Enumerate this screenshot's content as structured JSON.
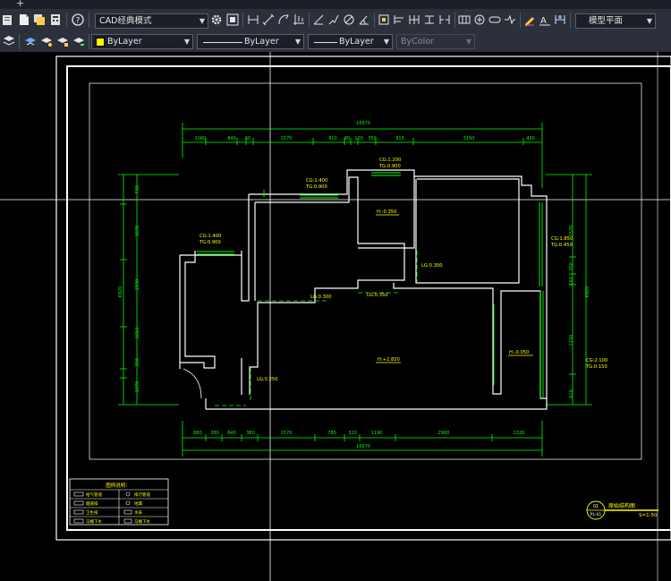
{
  "tabs": {
    "add_label": "+"
  },
  "toolbar": {
    "workspace": "CAD经典模式",
    "layout_combo": "模型平面",
    "color_combo": "ByLayer",
    "linetype_combo": "ByLayer",
    "lineweight_combo": "ByLayer",
    "plotstyle_combo": "ByColor"
  },
  "drawing": {
    "overall_top": "16970",
    "top_dims": [
      "1060",
      "840",
      "50",
      "1570",
      "910",
      "80",
      "100",
      "350",
      "915",
      "3150",
      "430"
    ],
    "bottom_dims": [
      "880",
      "380",
      "840",
      "380",
      "1570",
      "780",
      "320",
      "1190",
      "2900",
      "1320"
    ],
    "overall_bottom": "16970",
    "left_dims": [
      "730",
      "1670",
      "1930",
      "1610",
      "350",
      "1070"
    ],
    "left_overall": "6920",
    "right_dims": [
      "1570",
      "350",
      "160",
      "2150",
      "610"
    ],
    "right_overall": "6920",
    "labels": {
      "cg_1400_a": "CG:1.400",
      "tg_0900_a": "TG:0.900",
      "cg_1200": "CG:1.200",
      "tg_0900_b": "TG:0.900",
      "cg_1400_b": "CG:1.400",
      "tg_0900_c": "TG:0.900",
      "cg_1850": "CG:1.850",
      "tg_0450": "TG:0.450",
      "cg_2100": "CG:2.100",
      "tg_0150": "TG:0.150",
      "h_0350": "H:-0.350",
      "h_2820": "H:+2.820",
      "h_0050": "H:-0.050",
      "lg_0300_a": "LG:0.300",
      "lg_0300_b": "LG:0.300",
      "lg_0350": "LG:0.350",
      "lg_0250": "LG:0.250"
    },
    "legend": {
      "title": "图例说明：",
      "rows": [
        [
          "给气管道",
          "排污管道"
        ],
        [
          "烟道排",
          "地漏"
        ],
        [
          "卫生排",
          "水表"
        ],
        [
          "马桶下水",
          "马桶下水"
        ]
      ]
    },
    "title_block": {
      "number": "01",
      "code": "PL-01",
      "title": "原始结构图",
      "scale": "S=1:50"
    }
  },
  "colors": {
    "background": "#000000",
    "toolbar": "#2b303a",
    "dim": "#00ff00",
    "text": "#ffff00",
    "wall": "#ffffff"
  }
}
